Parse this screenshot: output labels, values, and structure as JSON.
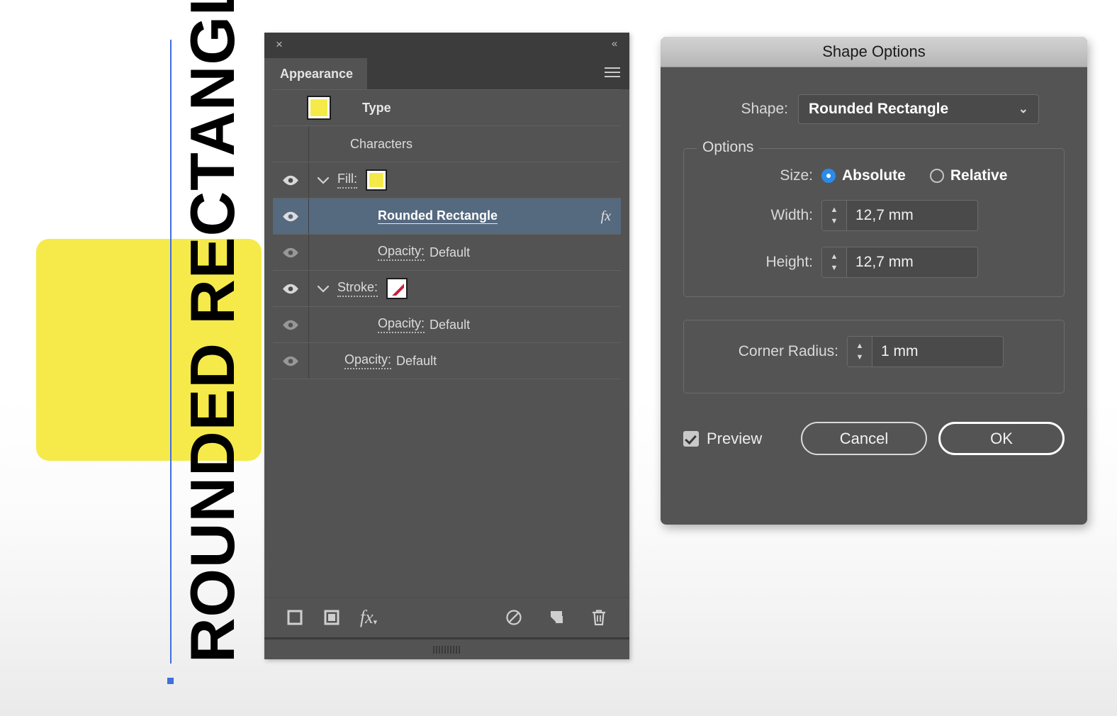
{
  "artwork": {
    "text": "ROUNDED RECTANGLE",
    "rect_color": "#F5EA4A",
    "guide_color": "#3F6FE0"
  },
  "appearance_panel": {
    "close_icon": "×",
    "collapse_icon": "«",
    "tab_label": "Appearance",
    "rows": [
      {
        "name": "type",
        "label": "Type",
        "value": "",
        "swatch": "#F5EA4A",
        "eye": false,
        "caret": "",
        "selected": false,
        "fx": false
      },
      {
        "name": "characters",
        "label": "Characters",
        "value": "",
        "eye": false,
        "caret": "",
        "selected": false,
        "fx": false
      },
      {
        "name": "fill",
        "label": "Fill:",
        "value": "",
        "swatch": "#F5EA4A",
        "eye": true,
        "caret": "⌄",
        "selected": false,
        "fx": false
      },
      {
        "name": "rounded-rectangle",
        "label": "Rounded Rectangle",
        "value": "",
        "eye": true,
        "caret": "",
        "selected": true,
        "fx": true,
        "fx_label": "fx"
      },
      {
        "name": "fill-opacity",
        "label": "Opacity:",
        "value": "Default",
        "eye": true,
        "caret": "",
        "selected": false,
        "fx": false
      },
      {
        "name": "stroke",
        "label": "Stroke:",
        "value": "",
        "swatch": "none",
        "eye": true,
        "caret": "⌄",
        "selected": false,
        "fx": false
      },
      {
        "name": "stroke-opacity",
        "label": "Opacity:",
        "value": "Default",
        "eye": true,
        "caret": "",
        "selected": false,
        "fx": false
      },
      {
        "name": "object-opacity",
        "label": "Opacity:",
        "value": "Default",
        "eye": true,
        "caret": "",
        "selected": false,
        "fx": false
      }
    ],
    "footer_icons": [
      {
        "name": "add-new-stroke-icon",
        "glyph": "▢"
      },
      {
        "name": "add-new-fill-icon",
        "glyph": "▣"
      },
      {
        "name": "add-new-effect-icon",
        "glyph": "fx"
      },
      {
        "name": "clear-appearance-icon",
        "glyph": "⊘"
      },
      {
        "name": "duplicate-item-icon",
        "glyph": "❐"
      },
      {
        "name": "delete-item-icon",
        "glyph": "🗑"
      }
    ]
  },
  "shape_dialog": {
    "title": "Shape Options",
    "shape_label": "Shape:",
    "shape_value": "Rounded Rectangle",
    "options_legend": "Options",
    "size_label": "Size:",
    "size_absolute_label": "Absolute",
    "size_relative_label": "Relative",
    "size_selected": "Absolute",
    "width_label": "Width:",
    "width_value": "12,7 mm",
    "height_label": "Height:",
    "height_value": "12,7 mm",
    "corner_radius_label": "Corner Radius:",
    "corner_radius_value": "1 mm",
    "preview_label": "Preview",
    "preview_checked": true,
    "cancel_label": "Cancel",
    "ok_label": "OK",
    "accent_color": "#2A8BE8"
  }
}
